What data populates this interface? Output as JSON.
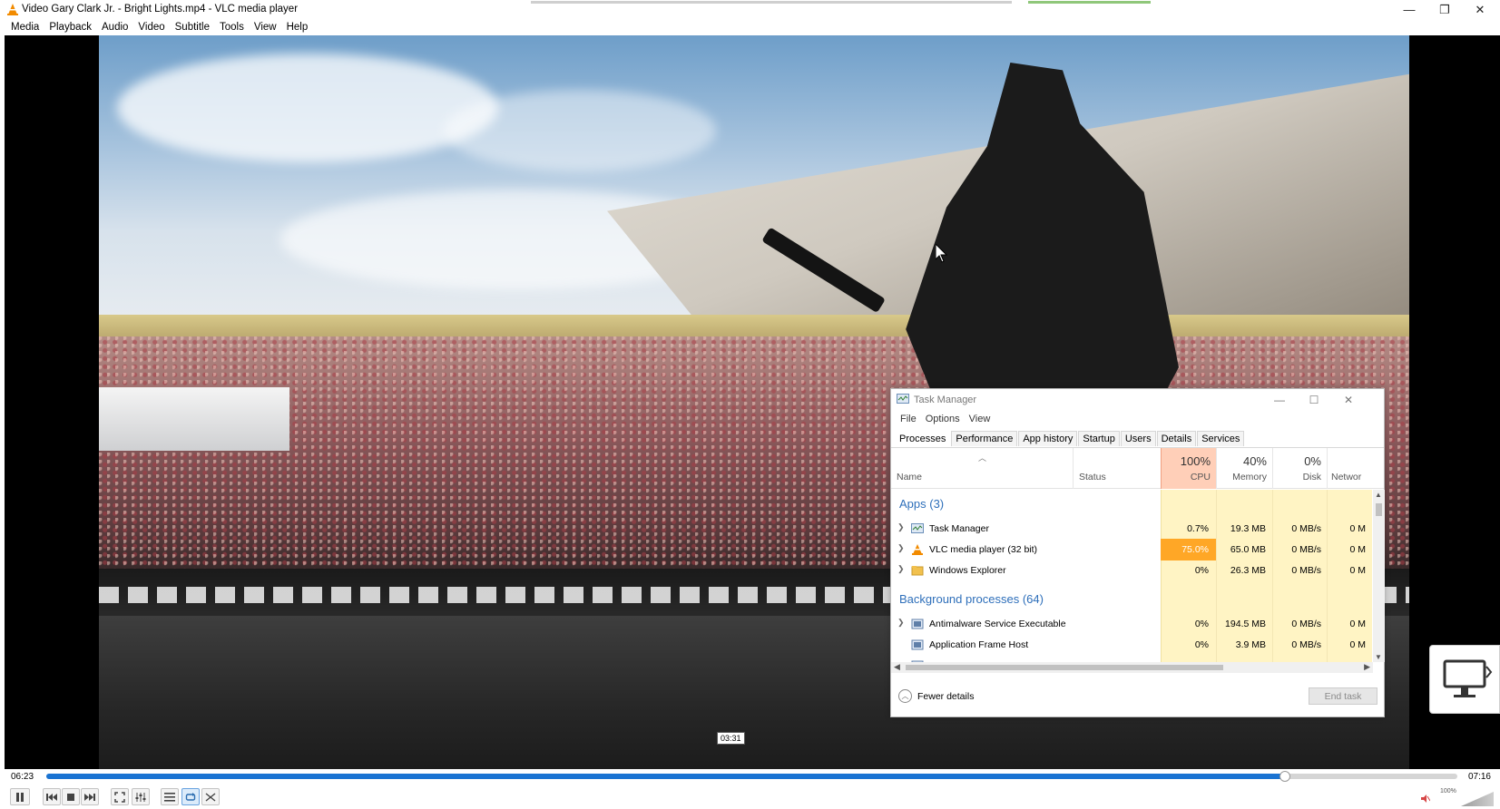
{
  "window": {
    "title": "Video Gary Clark Jr. - Bright Lights.mp4 - VLC media player",
    "minimize_glyph": "—",
    "restore_glyph": "❐",
    "close_glyph": "✕"
  },
  "menu": [
    "Media",
    "Playback",
    "Audio",
    "Video",
    "Subtitle",
    "Tools",
    "View",
    "Help"
  ],
  "video": {
    "hover_time": "03:31"
  },
  "task_manager": {
    "title": "Task Manager",
    "menu": [
      "File",
      "Options",
      "View"
    ],
    "tabs": [
      "Processes",
      "Performance",
      "App history",
      "Startup",
      "Users",
      "Details",
      "Services"
    ],
    "active_tab": "Processes",
    "columns": {
      "name": "Name",
      "status": "Status",
      "cpu_pct": "100%",
      "cpu_label": "CPU",
      "mem_pct": "40%",
      "mem_label": "Memory",
      "disk_pct": "0%",
      "disk_label": "Disk",
      "net_label": "Networ"
    },
    "groups": {
      "apps": "Apps (3)",
      "background": "Background processes (64)"
    },
    "rows": [
      {
        "name": "Task Manager",
        "cpu": "0.7%",
        "memory": "19.3 MB",
        "disk": "0 MB/s",
        "network": "0 M",
        "icon": "task-manager-icon"
      },
      {
        "name": "VLC media player (32 bit)",
        "cpu": "75.0%",
        "memory": "65.0 MB",
        "disk": "0 MB/s",
        "network": "0 M",
        "icon": "vlc-cone-icon"
      },
      {
        "name": "Windows Explorer",
        "cpu": "0%",
        "memory": "26.3 MB",
        "disk": "0 MB/s",
        "network": "0 M",
        "icon": "folder-icon"
      },
      {
        "name": "Antimalware Service Executable",
        "cpu": "0%",
        "memory": "194.5 MB",
        "disk": "0 MB/s",
        "network": "0 M",
        "icon": "service-icon"
      },
      {
        "name": "Application Frame Host",
        "cpu": "0%",
        "memory": "3.9 MB",
        "disk": "0 MB/s",
        "network": "0 M",
        "icon": "service-icon"
      }
    ],
    "footer": {
      "fewer_details": "Fewer details",
      "end_task": "End task"
    },
    "colors": {
      "cpu_header": "#ffcfb8",
      "heat_light": "#fff4c4",
      "heat_high": "#ffa726",
      "group_text": "#2e6fba"
    }
  },
  "player": {
    "elapsed": "06:23",
    "total": "07:16",
    "progress": 0.878,
    "volume_label": "100%",
    "accent": "#1a73d2"
  }
}
